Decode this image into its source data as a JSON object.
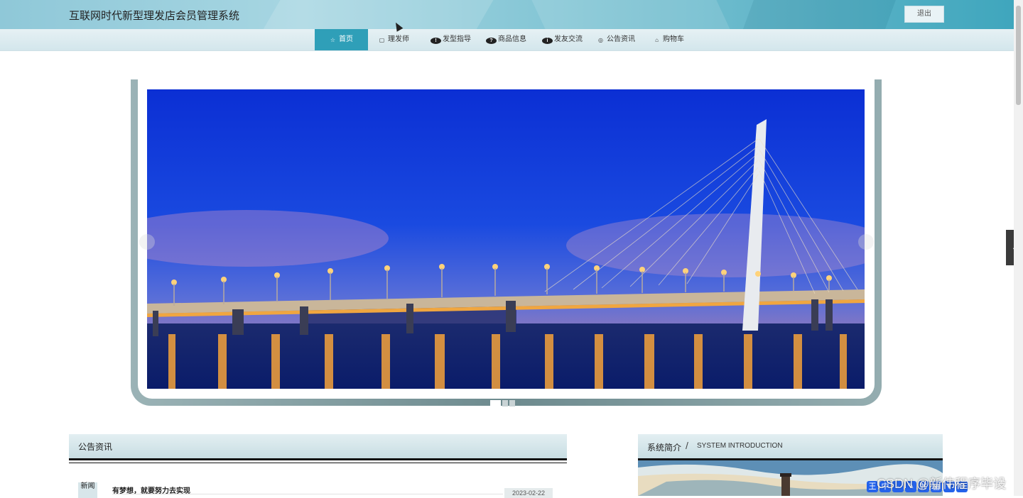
{
  "header": {
    "site_title": "互联网时代新型理发店会员管理系统",
    "logout_label": "退出"
  },
  "nav": {
    "items": [
      {
        "label": "首页",
        "icon": "star-icon",
        "glyph": "☆"
      },
      {
        "label": "理发师",
        "icon": "bag-icon",
        "glyph": "▢"
      },
      {
        "label": "发型指导",
        "icon": "info-icon",
        "glyph": "!"
      },
      {
        "label": "商品信息",
        "icon": "question-icon",
        "glyph": "?"
      },
      {
        "label": "发友交流",
        "icon": "info-circle-icon",
        "glyph": "i"
      },
      {
        "label": "公告资讯",
        "icon": "settings-icon",
        "glyph": "◎"
      },
      {
        "label": "购物车",
        "icon": "cart-icon",
        "glyph": "⌂"
      }
    ],
    "active_index": 0
  },
  "carousel": {
    "slide_count": 3,
    "active_index": 0
  },
  "news": {
    "panel_title": "公告资讯",
    "items": [
      {
        "badge": "新闻",
        "title": "有梦想，就要努力去实现",
        "date": "2023-02-22"
      }
    ]
  },
  "intro": {
    "title": "系统简介",
    "slash": "/",
    "subtitle": "SYSTEM INTRODUCTION"
  },
  "watermark": "CSDN @新伟程序毕设",
  "side_toggle_glyph": "‹",
  "ime_glyphs": [
    "王",
    "中",
    "·",
    "✎",
    "⌘",
    "▦",
    "▼",
    "⚙"
  ],
  "colors": {
    "accent": "#2f9fb8",
    "header_gradient_end": "#3fa6bd"
  }
}
